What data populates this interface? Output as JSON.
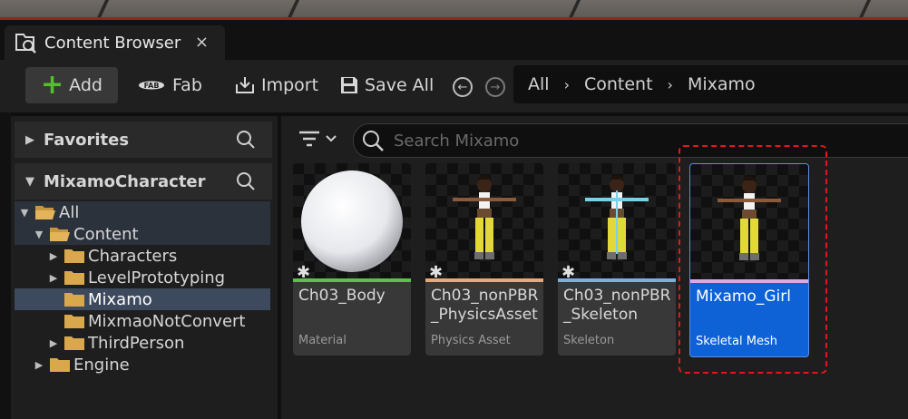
{
  "tab": {
    "title": "Content Browser",
    "close": "×"
  },
  "toolbar": {
    "add_label": "Add",
    "fab_label": "Fab",
    "import_label": "Import",
    "save_all_label": "Save All",
    "back": "←",
    "forward": "→"
  },
  "breadcrumb": [
    {
      "label": "All"
    },
    {
      "label": "Content"
    },
    {
      "label": "Mixamo"
    }
  ],
  "breadcrumb_separator": "›",
  "sidebar": {
    "favorites_label": "Favorites",
    "project_label": "MixamoCharacter",
    "tree": [
      {
        "label": "All",
        "expanded": true
      },
      {
        "label": "Content",
        "expanded": true
      },
      {
        "label": "Characters",
        "expanded": false
      },
      {
        "label": "LevelPrototyping",
        "expanded": false
      },
      {
        "label": "Mixamo",
        "selected": true
      },
      {
        "label": "MixmaoNotConvert"
      },
      {
        "label": "ThirdPerson",
        "expanded": false
      },
      {
        "label": "Engine",
        "expanded": false
      }
    ]
  },
  "search": {
    "placeholder": "Search Mixamo",
    "value": ""
  },
  "assets": [
    {
      "name": "Ch03_Body",
      "type": "Material",
      "stripe_color": "#5cc04a",
      "unsaved": true,
      "thumbnail": "sphere"
    },
    {
      "name": "Ch03_nonPBR_PhysicsAsset",
      "type": "Physics Asset",
      "stripe_color": "#e8a878",
      "unsaved": true,
      "thumbnail": "character-physics"
    },
    {
      "name": "Ch03_nonPBR_Skeleton",
      "type": "Skeleton",
      "stripe_color": "#7ab0e0",
      "unsaved": true,
      "thumbnail": "character-skeleton"
    },
    {
      "name": "Mixamo_Girl",
      "type": "Skeletal Mesh",
      "stripe_color": "#d8a8e8",
      "unsaved": false,
      "selected": true,
      "thumbnail": "character"
    }
  ],
  "colors": {
    "accent_selected": "#0e62d6",
    "add_plus": "#52c02e",
    "highlight_dashes": "#e01818"
  }
}
